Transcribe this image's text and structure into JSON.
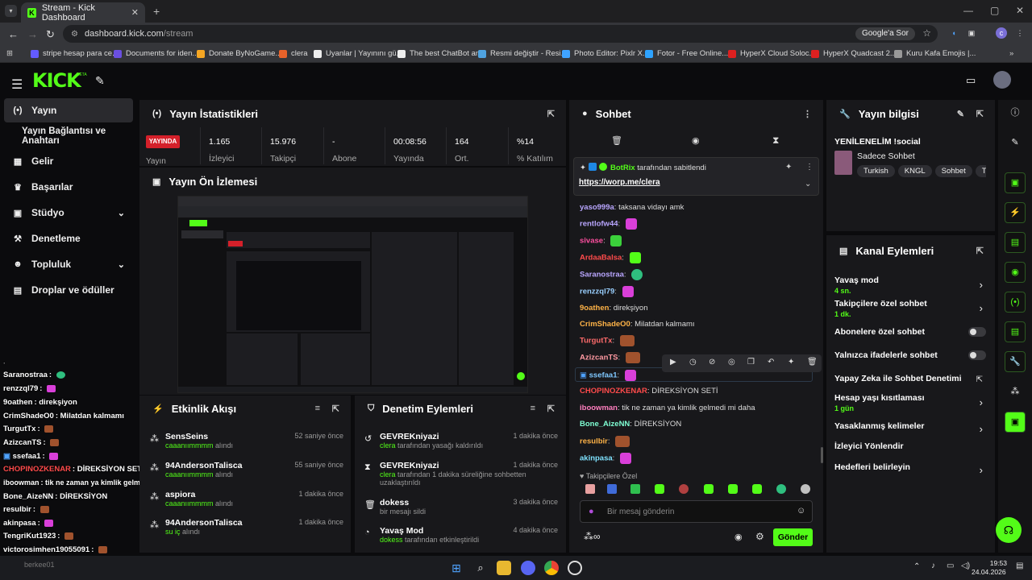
{
  "browser": {
    "tab_title": "Stream - Kick Dashboard",
    "tab_close": "✕",
    "new_tab": "+",
    "url_host": "dashboard.kick.com",
    "url_path": "/stream",
    "google_chip": "Google'a Sor",
    "bookmarks": [
      "stripe hesap para ce...",
      "Documents for iden...",
      "Donate ByNoGame...",
      "clera",
      "Uyanlar | Yayınını gü...",
      "The best ChatBot an...",
      "Resmi değiştir - Resi...",
      "Photo Editor: Pixlr X...",
      "Fotor - Free Online...",
      "HyperX Cloud Soloc...",
      "HyperX Quadcast 2...",
      "Kuru Kafa Emojis |..."
    ],
    "bookmark_colors": [
      "#635bff",
      "#6a4fe0",
      "#f5a623",
      "#e8622a",
      "#eee",
      "#eee",
      "#4fa3e0",
      "#3fa3ff",
      "#2ea3ff",
      "#dd2020",
      "#dd2020",
      "#999"
    ]
  },
  "kick": {
    "logo": "KICK",
    "beta": "BETA"
  },
  "sidebar": {
    "items": [
      {
        "label": "Yayın",
        "icon": "(•)"
      },
      {
        "label": "Yayın Bağlantısı ve Anahtarı",
        "icon": ""
      },
      {
        "label": "Gelir",
        "icon": "▦"
      },
      {
        "label": "Başarılar",
        "icon": "🏆"
      },
      {
        "label": "Stüdyo",
        "icon": "▣"
      },
      {
        "label": "Denetleme",
        "icon": "🔨"
      },
      {
        "label": "Topluluk",
        "icon": "👥"
      },
      {
        "label": "Droplar ve ödüller",
        "icon": "▤"
      }
    ]
  },
  "overlay_chat": [
    {
      "user": "Saranostraa",
      "msg": "",
      "color": "#fff"
    },
    {
      "user": "renzzql79",
      "msg": "",
      "color": "#fff"
    },
    {
      "user": "9oathen",
      "msg": "direkşiyon",
      "color": "#fff"
    },
    {
      "user": "CrimShadeO0",
      "msg": "Milatdan kalmamı",
      "color": "#fff"
    },
    {
      "user": "TurgutTx",
      "msg": "",
      "color": "#fff"
    },
    {
      "user": "AzizcanTS",
      "msg": "",
      "color": "#fff"
    },
    {
      "user": "ssefaa1",
      "msg": "",
      "color": "#fff"
    },
    {
      "user": "CHOPINOZKENAR",
      "msg": "DİREKSİYON SETİ",
      "color": "#ff4b4b"
    },
    {
      "user": "iboowman",
      "msg": "tik ne zaman ya kimlik gelmedi mi daha",
      "color": "#fff"
    },
    {
      "user": "Bone_AizeNN",
      "msg": "DİREKSİYON",
      "color": "#fff"
    },
    {
      "user": "resulbir",
      "msg": "",
      "color": "#fff"
    },
    {
      "user": "akinpasa",
      "msg": "",
      "color": "#fff"
    },
    {
      "user": "TengriKut1923",
      "msg": "",
      "color": "#fff"
    },
    {
      "user": "victorosimhen19055091",
      "msg": "",
      "color": "#fff"
    },
    {
      "user": "berkee01",
      "msg": "",
      "color": "#777"
    }
  ],
  "stats": {
    "title": "Yayın İstatistikleri",
    "live_badge": "YAYINDA",
    "live_label": "Yayın",
    "cells": [
      {
        "value": "1.165",
        "label": "İzleyici"
      },
      {
        "value": "15.976",
        "label": "Takipçi"
      },
      {
        "value": "-",
        "label": "Abone"
      },
      {
        "value": "00:08:56",
        "label": "Yayında"
      },
      {
        "value": "164",
        "label": "Ort."
      },
      {
        "value": "%14",
        "label": "% Katılım"
      }
    ]
  },
  "preview": {
    "title": "Yayın Ön İzlemesi"
  },
  "activity": {
    "title": "Etkinlik Akışı",
    "items": [
      {
        "name": "SensSeins",
        "sub": "caaanıımmmm",
        "sub2": "alındı",
        "time": "52 saniye önce"
      },
      {
        "name": "94AndersonTalisca",
        "sub": "caaanıımmmm",
        "sub2": "alındı",
        "time": "55 saniye önce"
      },
      {
        "name": "aspiora",
        "sub": "caaanıımmmm",
        "sub2": "alındı",
        "time": "1 dakika önce"
      },
      {
        "name": "94AndersonTalisca",
        "sub": "su iç",
        "sub2": "alındı",
        "time": "1 dakika önce"
      }
    ]
  },
  "mod": {
    "title": "Denetim Eylemleri",
    "items": [
      {
        "name": "GEVREKniyazi",
        "who": "clera",
        "text": "tarafından yasağı kaldırıldı",
        "text2": "",
        "time": "1 dakika önce",
        "icon": "↺"
      },
      {
        "name": "GEVREKniyazi",
        "who": "clera",
        "text": "tarafından 1 dakika süreliğine sohbetten",
        "text2": "uzaklaştırıldı",
        "time": "1 dakika önce",
        "icon": "⧗"
      },
      {
        "name": "dokess",
        "who": "",
        "text": "bir mesajı sildi",
        "text2": "",
        "time": "3 dakika önce",
        "icon": "🗑"
      },
      {
        "name": "Yavaş Mod",
        "who": "dokess",
        "text": "tarafından etkinleştirildi",
        "text2": "",
        "time": "4 dakika önce",
        "icon": "⏱"
      }
    ]
  },
  "chat": {
    "title": "Sohbet",
    "pinned_by": "BotRix",
    "pinned_text": "tarafından sabitlendi",
    "pinned_link": "https://worp.me/clera",
    "messages": [
      {
        "user": "yaso999a",
        "msg": "taksana vidayı amk",
        "color": "#b9a6ff",
        "emote": ""
      },
      {
        "user": "rentlofw44",
        "msg": "",
        "color": "#b9a6ff",
        "emote": "#d93fd9"
      },
      {
        "user": "sivase",
        "msg": "",
        "color": "#ff4fa0",
        "emote": "#3bd13b"
      },
      {
        "user": "ArdaaBalsa",
        "msg": "",
        "color": "#ff4b4b",
        "emote": "#53fc18"
      },
      {
        "user": "Saranostraa",
        "msg": "",
        "color": "#b9a6ff",
        "emote": "#2fbf7f"
      },
      {
        "user": "renzzql79",
        "msg": "",
        "color": "#9ad0ff",
        "emote": "#d93fd9"
      },
      {
        "user": "9oathen",
        "msg": "direkşiyon",
        "color": "#ffb347",
        "emote": ""
      },
      {
        "user": "CrimShadeO0",
        "msg": "Milatdan kalmamı",
        "color": "#ffb347",
        "emote": ""
      },
      {
        "user": "TurgutTx",
        "msg": "",
        "color": "#ff6b6b",
        "emote": "#a0522d"
      },
      {
        "user": "AzizcanTS",
        "msg": "",
        "color": "#ff9aa2",
        "emote": "#a0522d"
      },
      {
        "user": "ssefaa1",
        "msg": "",
        "color": "#7fc8ff",
        "emote": "#d93fd9"
      },
      {
        "user": "CHOPINOZKENAR",
        "msg": "DİREKSİYON SETİ",
        "color": "#ff4b4b",
        "emote": ""
      },
      {
        "user": "iboowman",
        "msg": "tik ne zaman ya kimlik gelmedi mi daha",
        "color": "#ff7fbf",
        "emote": ""
      },
      {
        "user": "Bone_AizeNN",
        "msg": "DİREKSİYON",
        "color": "#7fffd4",
        "emote": ""
      },
      {
        "user": "resulbir",
        "msg": "",
        "color": "#ffb347",
        "emote": "#a0522d"
      },
      {
        "user": "akinpasa",
        "msg": "",
        "color": "#7fe3ff",
        "emote": "#d93fd9"
      }
    ],
    "followers_only": "Takipçilere Özel",
    "input_placeholder": "Bir mesaj gönderin",
    "send": "Gönder"
  },
  "stream_info": {
    "title": "Yayın bilgisi",
    "stream_title": "YENİLENELİM !social",
    "category": "Sadece Sohbet",
    "tags": [
      "Turkish",
      "KNGL",
      "Sohbet",
      "Türk"
    ]
  },
  "channel_actions": {
    "title": "Kanal Eylemleri",
    "items": [
      {
        "label": "Yavaş mod",
        "sub": "4 sn.",
        "ctrl": "arrow"
      },
      {
        "label": "Takipçilere özel sohbet",
        "sub": "1 dk.",
        "ctrl": "arrow"
      },
      {
        "label": "Abonelere özel sohbet",
        "sub": "",
        "ctrl": "toggle"
      },
      {
        "label": "Yalnızca ifadelerle sohbet",
        "sub": "",
        "ctrl": "toggle"
      },
      {
        "label": "Yapay Zeka ile Sohbet Denetimi",
        "sub": "",
        "ctrl": "ext"
      },
      {
        "label": "Hesap yaşı kısıtlaması",
        "sub": "1 gün",
        "ctrl": "arrow"
      },
      {
        "label": "Yasaklanmış kelimeler",
        "sub": "",
        "ctrl": "arrow"
      },
      {
        "label": "İzleyici Yönlendir",
        "sub": "",
        "ctrl": "none"
      },
      {
        "label": "Hedefleri belirleyin",
        "sub": "",
        "ctrl": "arrow"
      }
    ]
  },
  "taskbar": {
    "time": "19:53",
    "date": "24.04.2026"
  }
}
